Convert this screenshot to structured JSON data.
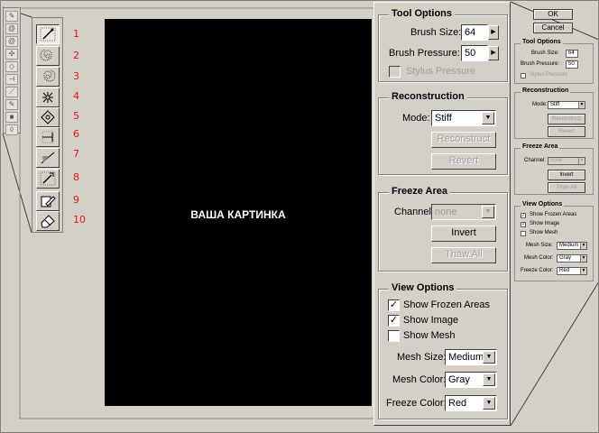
{
  "canvas": {
    "label": "ВАША КАРТИНКА",
    "background": "#000000"
  },
  "toolbar": {
    "tools": [
      {
        "num": "1",
        "icon": "warp-icon",
        "active": true
      },
      {
        "num": "2",
        "icon": "twirl-clockwise-icon",
        "active": false
      },
      {
        "num": "3",
        "icon": "twirl-counterclockwise-icon",
        "active": false
      },
      {
        "num": "4",
        "icon": "pucker-icon",
        "active": false
      },
      {
        "num": "5",
        "icon": "bloat-icon",
        "active": false
      },
      {
        "num": "6",
        "icon": "shift-pixels-icon",
        "active": false
      },
      {
        "num": "7",
        "icon": "reflection-icon",
        "active": false
      },
      {
        "num": "8",
        "icon": "reconstruct-icon",
        "active": false
      },
      {
        "num": "9",
        "icon": "freeze-icon",
        "active": false
      },
      {
        "num": "10",
        "icon": "thaw-icon",
        "active": false
      }
    ],
    "number_color": "#e0161e"
  },
  "tool_options": {
    "title": "Tool Options",
    "brush_size_label": "Brush Size:",
    "brush_size_value": "64",
    "brush_pressure_label": "Brush Pressure:",
    "brush_pressure_value": "50",
    "stylus_pressure_label": "Stylus Pressure"
  },
  "reconstruction": {
    "title": "Reconstruction",
    "mode_label": "Mode:",
    "mode_value": "Stiff",
    "reconstruct_label": "Reconstruct",
    "revert_label": "Revert"
  },
  "freeze_area": {
    "title": "Freeze Area",
    "channel_label": "Channel:",
    "channel_value": "none",
    "invert_label": "Invert",
    "thaw_all_label": "Thaw All"
  },
  "view_options": {
    "title": "View Options",
    "show_frozen_label": "Show Frozen Areas",
    "show_frozen_checked": true,
    "show_image_label": "Show Image",
    "show_image_checked": true,
    "show_mesh_label": "Show Mesh",
    "show_mesh_checked": false,
    "mesh_size_label": "Mesh Size:",
    "mesh_size_value": "Medium",
    "mesh_color_label": "Mesh Color:",
    "mesh_color_value": "Gray",
    "freeze_color_label": "Freeze Color:",
    "freeze_color_value": "Red"
  },
  "dialog_buttons": {
    "ok_label": "OK",
    "cancel_label": "Cancel"
  }
}
